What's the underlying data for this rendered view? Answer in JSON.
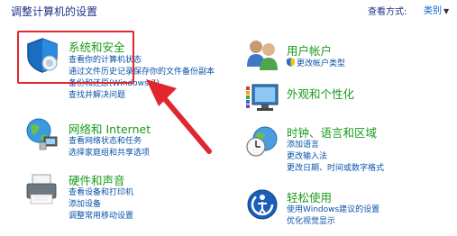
{
  "header": {
    "title": "调整计算机的设置",
    "view_by_label": "查看方式:",
    "view_by_value": "类别"
  },
  "categories": [
    {
      "title": "系统和安全",
      "links": [
        "查看你的计算机状态",
        "通过文件历史记录保存你的文件备份副本",
        "备份和还原(Windows 7)",
        "查找并解决问题"
      ]
    },
    {
      "title": "网络和 Internet",
      "links": [
        "查看网络状态和任务",
        "选择家庭组和共享选项"
      ]
    },
    {
      "title": "硬件和声音",
      "links": [
        "查看设备和打印机",
        "添加设备",
        "调整常用移动设置"
      ]
    },
    {
      "title": "用户帐户",
      "links": [
        "更改帐户类型"
      ]
    },
    {
      "title": "外观和个性化",
      "links": []
    },
    {
      "title": "时钟、语言和区域",
      "links": [
        "添加语言",
        "更改输入法",
        "更改日期、时间或数字格式"
      ]
    },
    {
      "title": "轻松使用",
      "links": [
        "使用Windows建议的设置",
        "优化视觉显示"
      ]
    }
  ],
  "colors": {
    "title_green": "#1a9b1a",
    "link_blue": "#0a52a8",
    "highlight_red": "#e0262e"
  }
}
